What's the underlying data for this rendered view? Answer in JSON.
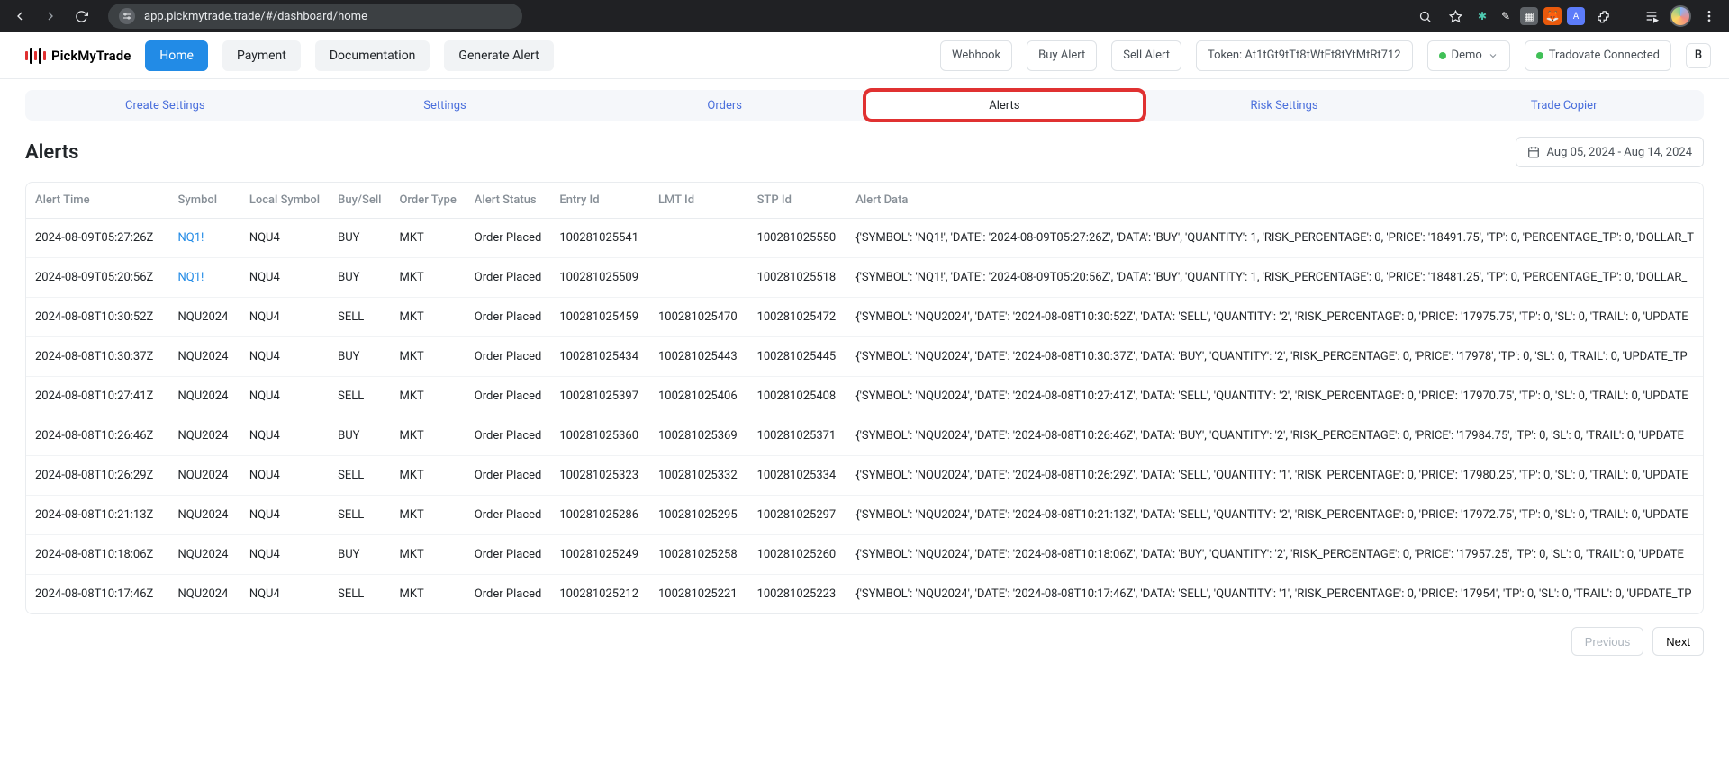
{
  "browser": {
    "url": "app.pickmytrade.trade/#/dashboard/home",
    "site_badge": "⚙"
  },
  "logo": {
    "text": "PickMyTrade"
  },
  "nav": {
    "home": "Home",
    "payment": "Payment",
    "documentation": "Documentation",
    "generate_alert": "Generate Alert"
  },
  "header_buttons": {
    "webhook": "Webhook",
    "buy_alert": "Buy Alert",
    "sell_alert": "Sell Alert",
    "token_label": "Token: At1tGt9tTt8tWtEt8tYtMtRt712",
    "env": "Demo",
    "connection": "Tradovate Connected",
    "user_initial": "B"
  },
  "tabs": {
    "create_settings": "Create Settings",
    "settings": "Settings",
    "orders": "Orders",
    "alerts": "Alerts",
    "risk_settings": "Risk Settings",
    "trade_copier": "Trade Copier"
  },
  "page": {
    "title": "Alerts",
    "date_range": "Aug 05, 2024 - Aug 14, 2024"
  },
  "columns": {
    "alert_time": "Alert Time",
    "symbol": "Symbol",
    "local_symbol": "Local Symbol",
    "buy_sell": "Buy/Sell",
    "order_type": "Order Type",
    "alert_status": "Alert Status",
    "entry_id": "Entry Id",
    "lmt_id": "LMT Id",
    "stp_id": "STP Id",
    "alert_data": "Alert Data"
  },
  "rows": [
    {
      "time": "2024-08-09T05:27:26Z",
      "symbol": "NQ1!",
      "lsym": "NQU4",
      "bs": "BUY",
      "ot": "MKT",
      "status": "Order Placed",
      "entry": "100281025541",
      "lmt": "",
      "stp": "100281025550",
      "data": "{'SYMBOL': 'NQ1!', 'DATE': '2024-08-09T05:27:26Z', 'DATA': 'BUY', 'QUANTITY': 1, 'RISK_PERCENTAGE': 0, 'PRICE': '18491.75', 'TP': 0, 'PERCENTAGE_TP': 0, 'DOLLAR_T",
      "sym_link": true
    },
    {
      "time": "2024-08-09T05:20:56Z",
      "symbol": "NQ1!",
      "lsym": "NQU4",
      "bs": "BUY",
      "ot": "MKT",
      "status": "Order Placed",
      "entry": "100281025509",
      "lmt": "",
      "stp": "100281025518",
      "data": "{'SYMBOL': 'NQ1!', 'DATE': '2024-08-09T05:20:56Z', 'DATA': 'BUY', 'QUANTITY': 1, 'RISK_PERCENTAGE': 0, 'PRICE': '18481.25', 'TP': 0, 'PERCENTAGE_TP': 0, 'DOLLAR_",
      "sym_link": true
    },
    {
      "time": "2024-08-08T10:30:52Z",
      "symbol": "NQU2024",
      "lsym": "NQU4",
      "bs": "SELL",
      "ot": "MKT",
      "status": "Order Placed",
      "entry": "100281025459",
      "lmt": "100281025470",
      "stp": "100281025472",
      "data": "{'SYMBOL': 'NQU2024', 'DATE': '2024-08-08T10:30:52Z', 'DATA': 'SELL', 'QUANTITY': '2', 'RISK_PERCENTAGE': 0, 'PRICE': '17975.75', 'TP': 0, 'SL': 0, 'TRAIL': 0, 'UPDATE"
    },
    {
      "time": "2024-08-08T10:30:37Z",
      "symbol": "NQU2024",
      "lsym": "NQU4",
      "bs": "BUY",
      "ot": "MKT",
      "status": "Order Placed",
      "entry": "100281025434",
      "lmt": "100281025443",
      "stp": "100281025445",
      "data": "{'SYMBOL': 'NQU2024', 'DATE': '2024-08-08T10:30:37Z', 'DATA': 'BUY', 'QUANTITY': '2', 'RISK_PERCENTAGE': 0, 'PRICE': '17978', 'TP': 0, 'SL': 0, 'TRAIL': 0, 'UPDATE_TP"
    },
    {
      "time": "2024-08-08T10:27:41Z",
      "symbol": "NQU2024",
      "lsym": "NQU4",
      "bs": "SELL",
      "ot": "MKT",
      "status": "Order Placed",
      "entry": "100281025397",
      "lmt": "100281025406",
      "stp": "100281025408",
      "data": "{'SYMBOL': 'NQU2024', 'DATE': '2024-08-08T10:27:41Z', 'DATA': 'SELL', 'QUANTITY': '2', 'RISK_PERCENTAGE': 0, 'PRICE': '17970.75', 'TP': 0, 'SL': 0, 'TRAIL': 0, 'UPDATE"
    },
    {
      "time": "2024-08-08T10:26:46Z",
      "symbol": "NQU2024",
      "lsym": "NQU4",
      "bs": "BUY",
      "ot": "MKT",
      "status": "Order Placed",
      "entry": "100281025360",
      "lmt": "100281025369",
      "stp": "100281025371",
      "data": "{'SYMBOL': 'NQU2024', 'DATE': '2024-08-08T10:26:46Z', 'DATA': 'BUY', 'QUANTITY': '2', 'RISK_PERCENTAGE': 0, 'PRICE': '17984.75', 'TP': 0, 'SL': 0, 'TRAIL': 0, 'UPDATE"
    },
    {
      "time": "2024-08-08T10:26:29Z",
      "symbol": "NQU2024",
      "lsym": "NQU4",
      "bs": "SELL",
      "ot": "MKT",
      "status": "Order Placed",
      "entry": "100281025323",
      "lmt": "100281025332",
      "stp": "100281025334",
      "data": "{'SYMBOL': 'NQU2024', 'DATE': '2024-08-08T10:26:29Z', 'DATA': 'SELL', 'QUANTITY': '1', 'RISK_PERCENTAGE': 0, 'PRICE': '17980.25', 'TP': 0, 'SL': 0, 'TRAIL': 0, 'UPDATE"
    },
    {
      "time": "2024-08-08T10:21:13Z",
      "symbol": "NQU2024",
      "lsym": "NQU4",
      "bs": "SELL",
      "ot": "MKT",
      "status": "Order Placed",
      "entry": "100281025286",
      "lmt": "100281025295",
      "stp": "100281025297",
      "data": "{'SYMBOL': 'NQU2024', 'DATE': '2024-08-08T10:21:13Z', 'DATA': 'SELL', 'QUANTITY': '2', 'RISK_PERCENTAGE': 0, 'PRICE': '17972.75', 'TP': 0, 'SL': 0, 'TRAIL': 0, 'UPDATE"
    },
    {
      "time": "2024-08-08T10:18:06Z",
      "symbol": "NQU2024",
      "lsym": "NQU4",
      "bs": "BUY",
      "ot": "MKT",
      "status": "Order Placed",
      "entry": "100281025249",
      "lmt": "100281025258",
      "stp": "100281025260",
      "data": "{'SYMBOL': 'NQU2024', 'DATE': '2024-08-08T10:18:06Z', 'DATA': 'BUY', 'QUANTITY': '2', 'RISK_PERCENTAGE': 0, 'PRICE': '17957.25', 'TP': 0, 'SL': 0, 'TRAIL': 0, 'UPDATE"
    },
    {
      "time": "2024-08-08T10:17:46Z",
      "symbol": "NQU2024",
      "lsym": "NQU4",
      "bs": "SELL",
      "ot": "MKT",
      "status": "Order Placed",
      "entry": "100281025212",
      "lmt": "100281025221",
      "stp": "100281025223",
      "data": "{'SYMBOL': 'NQU2024', 'DATE': '2024-08-08T10:17:46Z', 'DATA': 'SELL', 'QUANTITY': '1', 'RISK_PERCENTAGE': 0, 'PRICE': '17954', 'TP': 0, 'SL': 0, 'TRAIL': 0, 'UPDATE_TP"
    }
  ],
  "pager": {
    "prev": "Previous",
    "next": "Next"
  }
}
